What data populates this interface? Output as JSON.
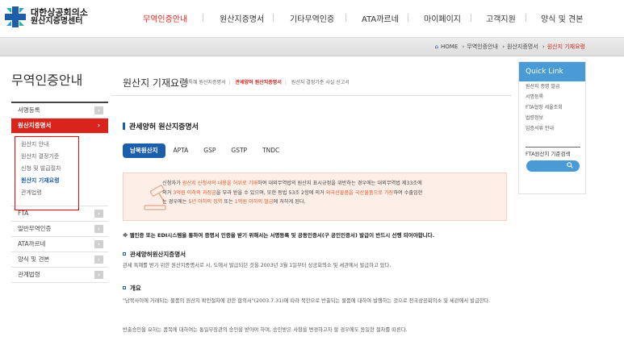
{
  "header": {
    "logo_line1": "대한상공회의소",
    "logo_line2": "원산지증명센터",
    "nav": [
      "무역인증안내",
      "원산지증명서",
      "기타무역인증",
      "ATA까르네",
      "마이페이지",
      "고객지원",
      "양식 및 견본"
    ]
  },
  "breadcrumb": [
    "HOME",
    "무역인증안내",
    "원산지증명서",
    "원산지 기재요령"
  ],
  "quick_link": {
    "title": "Quick Link",
    "items": [
      "원산지 증명 발급",
      "서명등록",
      "FTA협정 세율조회",
      "법령정보",
      "입증서류 안내"
    ],
    "search_label": "FTA원산지 기준검색",
    "search_icon": "search-icon"
  },
  "sidebar": {
    "title": "무역인증안내",
    "items_top": [
      "서명등록"
    ],
    "active_item": "원산지증명서",
    "sub_items": [
      "원산지 안내",
      "원산지 결정기준",
      "신청 및 발급절차",
      "원산지 기재요령",
      "관계법령"
    ],
    "items_bottom": [
      "FTA",
      "일반무역인증",
      "ATA까르네",
      "양식 및 견본",
      "관계법령"
    ],
    "highlight_color": "#ff0000"
  },
  "main": {
    "page_title": "원산지 기재요령",
    "page_tabs": [
      "비특혜 원산지증명서",
      "관세양허 원산지증명서",
      "원산지 결정기준 사실 신고서"
    ],
    "section_title": "관세양허 원산지증명서",
    "pills": [
      "남북원산지",
      "APTA",
      "GSP",
      "GSTP",
      "TNDC"
    ],
    "warning": {
      "line1_a": "신청자가 ",
      "line1_b": "원산지 신청서의 내용을 허위로 기재",
      "line1_c": "하여 대외무역법의 원산지 표시규정을 위반하는 경우에는 대외무역법 제33조에",
      "line2_a": "의거 ",
      "line2_b": "3억원 이하의 과징금",
      "line2_c": "을 부과 받을 수 있으며, 또한 동법 53조 2항에 의거 ",
      "line2_d": "외국산물품을 국산물품으로 가장",
      "line2_e": "하여 수출입한",
      "line3_a": "는 경우에는 ",
      "line3_b": "5년 이하의 징역",
      "line3_c": " 또는 ",
      "line3_d": "1억원 이하의 벌금",
      "line3_e": "에 처하게 된다."
    },
    "note": "※ 웹인증 또는 EDI시스템을 통하여 증명서 인증을 받기 위해서는 서명등록 및 공동인증서(구 공인인증서) 발급이 반드시 선행 되어야합니다.",
    "h_main": "관세양허원산지증명서",
    "p_main": "관세 특혜를 받기 위한 원산지증명서로 시, 도에서 발급되던 것을 2003년 3월 1일부터 상공회의소 및 세관에서 발급하고 있다.",
    "h_overview": "개요",
    "p_overview": "\"남북사이에 거래되는 물품의 원산지 확인절차에 관한 합의서\"(2003.7.31)에 따라 북한으로 반출되는 물품에 대하여 발행하는 것으로 전국상공회의소 및 세관에서 발급한다.",
    "p_last": "반출승인을 요하는 품목에 대하여는 통일부장관의 승인을 받아야 하며, 승인받은 사항을 변경하고자 할 경우에도 동일한 절차를 따른다."
  }
}
